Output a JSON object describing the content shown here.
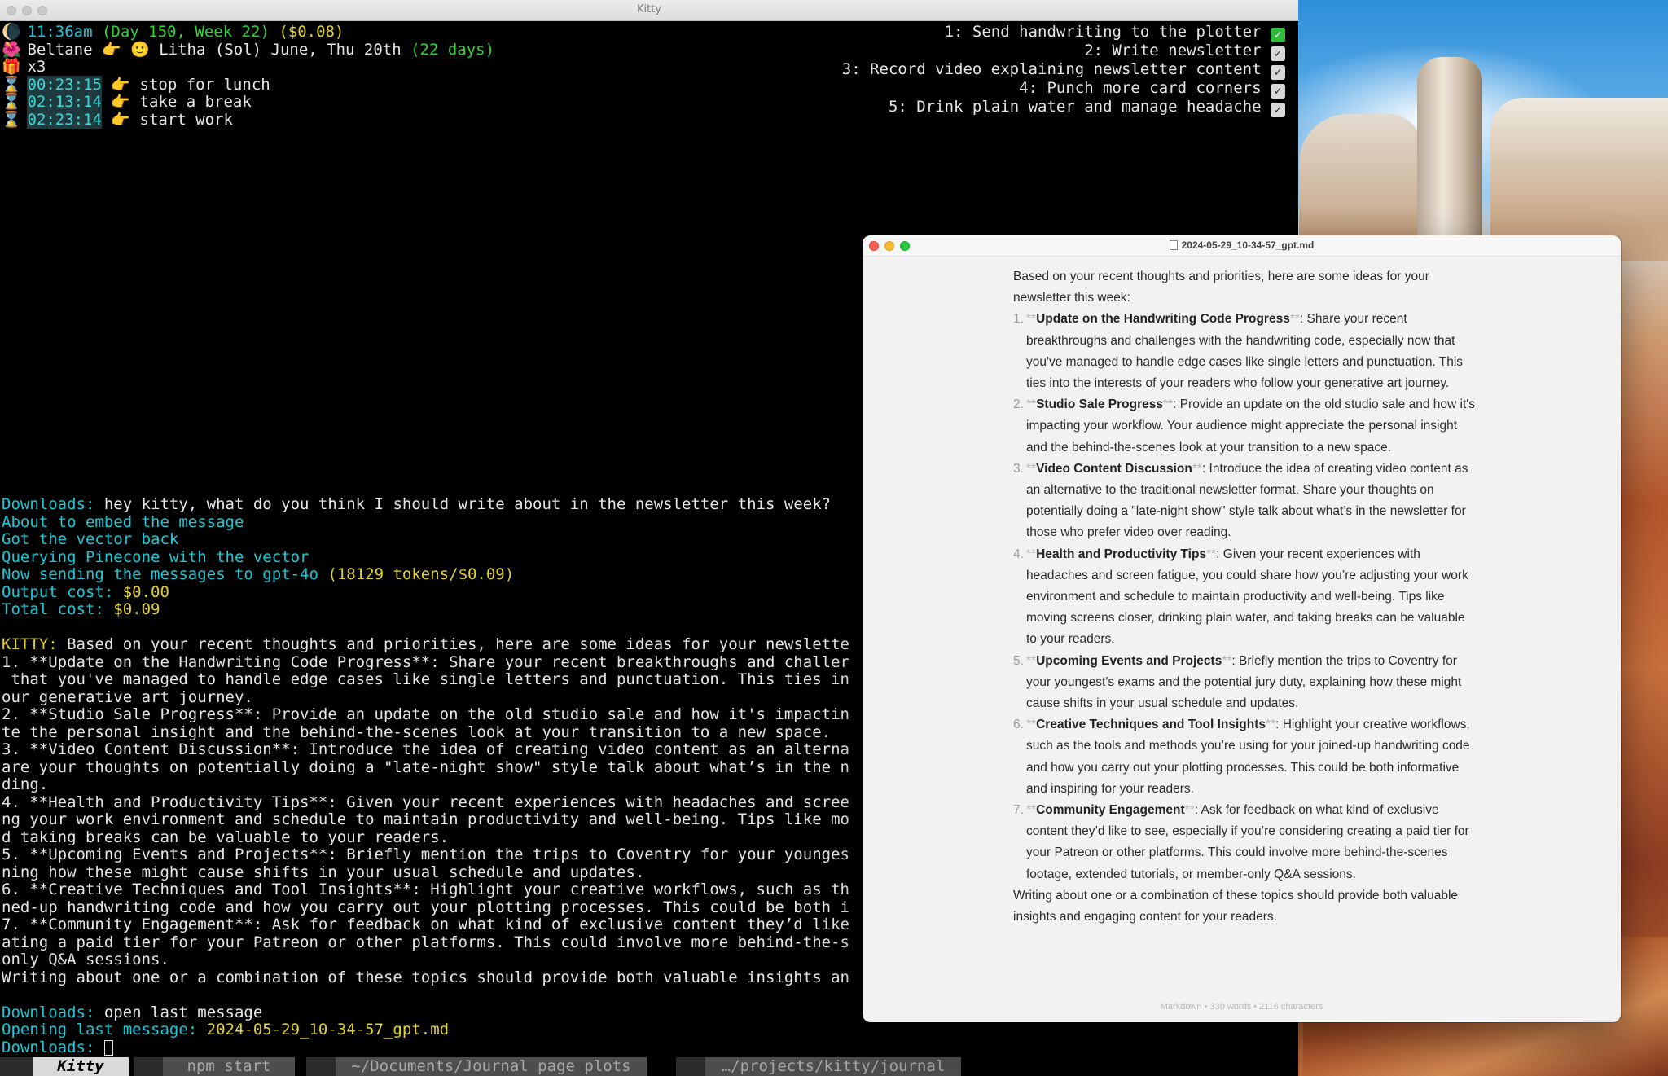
{
  "desktop": {
    "wallpaper": "canyon-landscape"
  },
  "kitty": {
    "window_title": "Kitty",
    "status": {
      "time": "11:36am",
      "day_week": "(Day 150, Week 22)",
      "cost": "($0.08)",
      "festival_from": "Beltane",
      "festival_to": "Litha (Sol) June, Thu 20th",
      "festival_days": "(22 days)",
      "multiplier": "x3"
    },
    "timers": [
      {
        "time": "00:23:15",
        "label": "stop for lunch"
      },
      {
        "time": "02:13:14",
        "label": "take a break"
      },
      {
        "time": "02:23:14",
        "label": "start work"
      }
    ],
    "todos": [
      {
        "text": "1: Send handwriting to the plotter",
        "done": true
      },
      {
        "text": "2: Write newsletter",
        "done": false
      },
      {
        "text": "3: Record video explaining newsletter content",
        "done": false
      },
      {
        "text": "4: Punch more card corners",
        "done": false
      },
      {
        "text": "5: Drink plain water and manage headache",
        "done": false
      }
    ],
    "log": {
      "prompt": "Downloads:",
      "user_input": " hey kitty, what do you think I should write about in the newsletter this week?",
      "line_embed": "About to embed the message",
      "line_vector": "Got the vector back",
      "line_pinecone": "Querying Pinecone with the vector",
      "line_sending": "Now sending the messages to gpt-4o",
      "line_sending_tokens": " (18129 tokens/$0.09)",
      "output_cost_label": "Output cost:",
      "output_cost": " $0.00",
      "total_cost_label": "Total cost:",
      "total_cost": " $0.09"
    },
    "reply": {
      "speaker": "KITTY:",
      "lines": [
        " Based on your recent thoughts and priorities, here are some ideas for your newslette",
        "1. **Update on the Handwriting Code Progress**: Share your recent breakthroughs and challer",
        " that you've managed to handle edge cases like single letters and punctuation. This ties in",
        "our generative art journey.",
        "2. **Studio Sale Progress**: Provide an update on the old studio sale and how it's impactin",
        "te the personal insight and the behind-the-scenes look at your transition to a new space.",
        "3. **Video Content Discussion**: Introduce the idea of creating video content as an alterna",
        "are your thoughts on potentially doing a \"late-night show\" style talk about what’s in the n",
        "ding.",
        "4. **Health and Productivity Tips**: Given your recent experiences with headaches and scree",
        "ng your work environment and schedule to maintain productivity and well-being. Tips like mo",
        "d taking breaks can be valuable to your readers.",
        "5. **Upcoming Events and Projects**: Briefly mention the trips to Coventry for your younges",
        "ning how these might cause shifts in your usual schedule and updates.",
        "6. **Creative Techniques and Tool Insights**: Highlight your creative workflows, such as th",
        "ned-up handwriting code and how you carry out your plotting processes. This could be both i",
        "7. **Community Engagement**: Ask for feedback on what kind of exclusive content they’d like",
        "ating a paid tier for your Patreon or other platforms. This could involve more behind-the-s",
        "only Q&A sessions.",
        "Writing about one or a combination of these topics should provide both valuable insights an"
      ]
    },
    "followup": {
      "prompt": "Downloads:",
      "command": " open last message",
      "opening_label": "Opening last message:",
      "opening_file": " 2024-05-29_10-34-57_gpt.md",
      "prompt2": "Downloads:"
    },
    "tabs": [
      {
        "label": "Kitty"
      },
      {
        "label": "npm start"
      },
      {
        "label": "~/Documents/Journal page plots"
      },
      {
        "label": "…/projects/kitty/journal"
      }
    ]
  },
  "markdown_window": {
    "title": "2024-05-29_10-34-57_gpt.md",
    "intro": "Based on your recent thoughts and priorities, here are some ideas for your newsletter this week:",
    "items": [
      {
        "num": "1.",
        "title": "Update on the Handwriting Code Progress",
        "text": ": Share your recent breakthroughs and challenges with the handwriting code, especially now that you've managed to handle edge cases like single letters and punctuation. This ties into the interests of your readers who follow your generative art journey."
      },
      {
        "num": "2.",
        "title": "Studio Sale Progress",
        "text": ": Provide an update on the old studio sale and how it's impacting your workflow. Your audience might appreciate the personal insight and the behind-the-scenes look at your transition to a new space."
      },
      {
        "num": "3.",
        "title": "Video Content Discussion",
        "text": ": Introduce the idea of creating video content as an alternative to the traditional newsletter format. Share your thoughts on potentially doing a \"late-night show\" style talk about what’s in the newsletter for those who prefer video over reading."
      },
      {
        "num": "4.",
        "title": "Health and Productivity Tips",
        "text": ": Given your recent experiences with headaches and screen fatigue, you could share how you’re adjusting your work environment and schedule to maintain productivity and well-being. Tips like moving screens closer, drinking plain water, and taking breaks can be valuable to your readers."
      },
      {
        "num": "5.",
        "title": "Upcoming Events and Projects",
        "text": ": Briefly mention the trips to Coventry for your youngest's exams and the potential jury duty, explaining how these might cause shifts in your usual schedule and updates."
      },
      {
        "num": "6.",
        "title": "Creative Techniques and Tool Insights",
        "text": ": Highlight your creative workflows, such as the tools and methods you’re using for your joined-up handwriting code and how you carry out your plotting processes. This could be both informative and inspiring for your readers."
      },
      {
        "num": "7.",
        "title": "Community Engagement",
        "text": ": Ask for feedback on what kind of exclusive content they’d like to see, especially if you’re considering creating a paid tier for your Patreon or other platforms. This could involve more behind-the-scenes footage, extended tutorials, or member-only Q&A sessions."
      }
    ],
    "bold_marker": "**",
    "outro": "Writing about one or a combination of these topics should provide both valuable insights and engaging content for your readers.",
    "status": "Markdown • 330 words • 2116 characters"
  }
}
